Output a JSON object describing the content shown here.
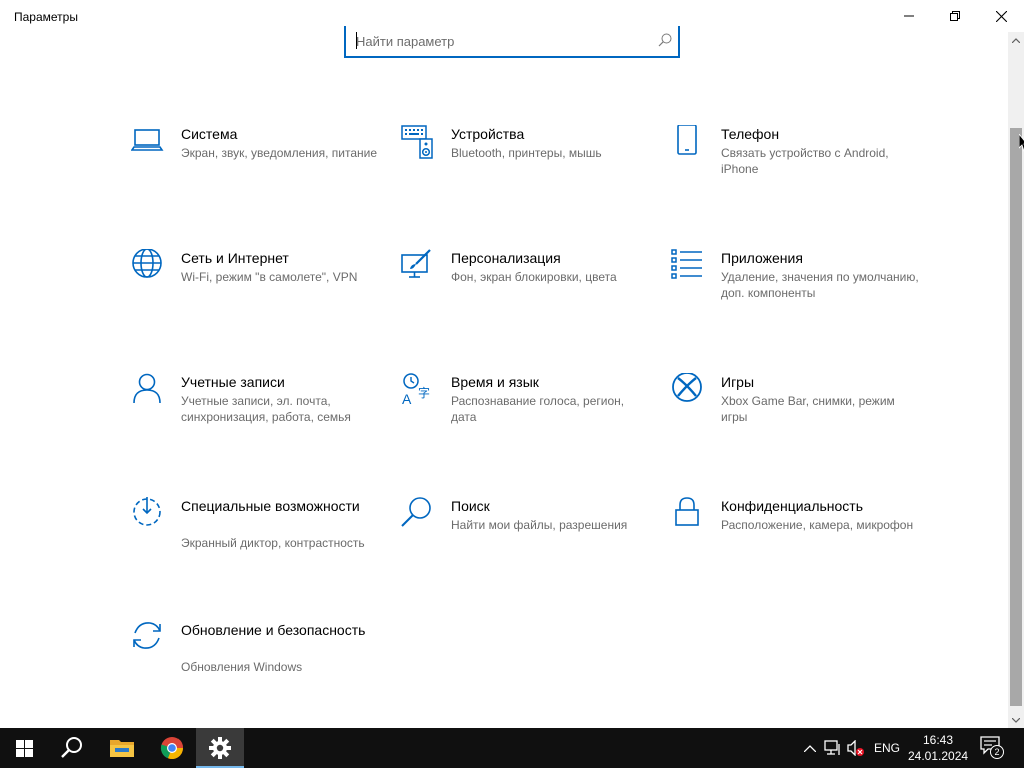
{
  "window": {
    "title": "Параметры"
  },
  "search": {
    "placeholder": "Найти параметр"
  },
  "tiles": [
    {
      "title": "Система",
      "desc": "Экран, звук, уведомления, питание",
      "icon": "laptop-icon"
    },
    {
      "title": "Устройства",
      "desc": "Bluetooth, принтеры, мышь",
      "icon": "devices-icon"
    },
    {
      "title": "Телефон",
      "desc": "Связать устройство с Android, iPhone",
      "icon": "phone-icon"
    },
    {
      "title": "Сеть и Интернет",
      "desc": "Wi-Fi, режим \"в самолете\", VPN",
      "icon": "globe-icon"
    },
    {
      "title": "Персонализация",
      "desc": "Фон, экран блокировки, цвета",
      "icon": "personalization-icon"
    },
    {
      "title": "Приложения",
      "desc": "Удаление, значения по умолчанию, доп. компоненты",
      "icon": "apps-list-icon"
    },
    {
      "title": "Учетные записи",
      "desc": "Учетные записи, эл. почта, синхронизация, работа, семья",
      "icon": "person-icon"
    },
    {
      "title": "Время и язык",
      "desc": "Распознавание голоса, регион, дата",
      "icon": "time-language-icon"
    },
    {
      "title": "Игры",
      "desc": "Xbox Game Bar, снимки, режим игры",
      "icon": "xbox-icon"
    },
    {
      "title": "Специальные возможности",
      "desc": "Экранный диктор, контрастность",
      "icon": "accessibility-icon"
    },
    {
      "title": "Поиск",
      "desc": "Найти мои файлы, разрешения",
      "icon": "search-magnifier-icon"
    },
    {
      "title": "Конфиденциальность",
      "desc": "Расположение, камера, микрофон",
      "icon": "lock-icon"
    },
    {
      "title": "Обновление и безопасность",
      "desc": "Обновления Windows",
      "icon": "update-sync-icon"
    }
  ],
  "taskbar": {
    "language": "ENG",
    "time": "16:43",
    "date": "24.01.2024",
    "notification_count": "2",
    "items": [
      "windows-start-icon",
      "search-icon",
      "file-explorer-icon",
      "chrome-icon",
      "settings-gear-icon"
    ]
  },
  "colors": {
    "accent": "#0067c0",
    "taskbar": "#101010",
    "description_text": "#6b6b6b"
  }
}
